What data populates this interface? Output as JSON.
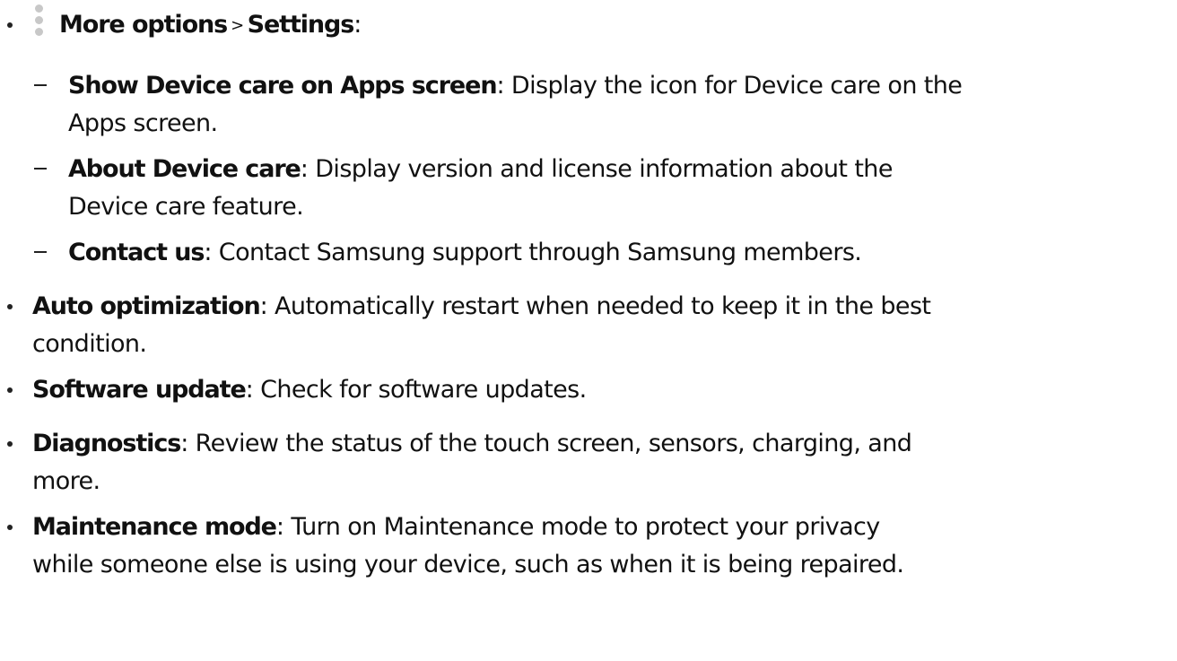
{
  "top": {
    "bold_label": "More options",
    "separator": ">",
    "bold_label_2": "Settings",
    "suffix": ":"
  },
  "sub_items": [
    {
      "label": "Show Device care on Apps screen",
      "colon": ":",
      "line1": " Display the icon for Device care on the",
      "line2": "Apps screen."
    },
    {
      "label": "About Device care",
      "colon": ":",
      "line1": " Display version and license information about the",
      "line2": "Device care feature."
    },
    {
      "label": "Contact us",
      "colon": ":",
      "line1": " Contact Samsung support through Samsung members."
    }
  ],
  "items": [
    {
      "label": "Auto optimization",
      "colon": ":",
      "line1": " Automatically restart when needed to keep it in the best",
      "line2": "condition."
    },
    {
      "label": "Software update",
      "colon": ":",
      "line1": " Check for software updates."
    },
    {
      "label": "Diagnostics",
      "colon": ":",
      "line1": " Review the status of the touch screen, sensors, charging, and",
      "line2": "more."
    },
    {
      "label": "Maintenance mode",
      "colon": ":",
      "line1": " Turn on Maintenance mode to protect your privacy",
      "line2": "while someone else is using your device, such as when it is being repaired."
    }
  ]
}
